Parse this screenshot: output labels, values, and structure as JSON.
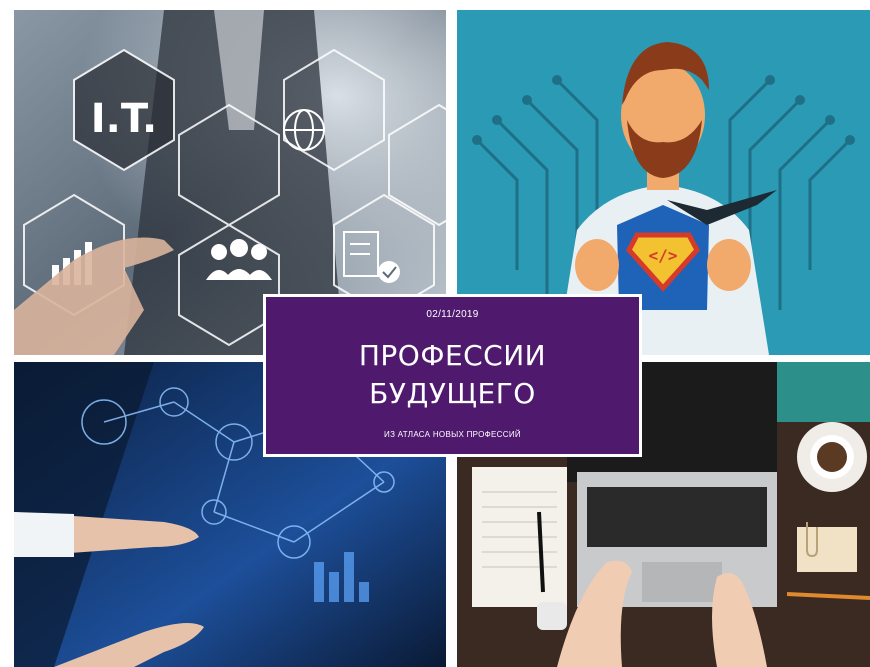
{
  "collage": {
    "date": "02/11/2019",
    "title_line_1": "ПРОФЕССИИ",
    "title_line_2": "БУДУЩЕГО",
    "subtitle": "ИЗ АТЛАСА НОВЫХ ПРОФЕССИЙ",
    "card_color": "#4f1a6e",
    "it_hexagon_text": "I.T."
  },
  "photos": [
    {
      "subject": "it-hexagon-network",
      "icons": [
        "chart-icon",
        "people-icon",
        "globe-icon",
        "document-check-icon",
        "hand-pointer"
      ]
    },
    {
      "subject": "programmer-superhero",
      "icons": [
        "code-emblem-icon",
        "circuit-lines"
      ]
    },
    {
      "subject": "data-visualization-screen",
      "icons": [
        "network-nodes"
      ]
    },
    {
      "subject": "laptop-desk",
      "icons": [
        "laptop",
        "notebook",
        "coffee-cup",
        "paper-clip-icon",
        "pen"
      ]
    }
  ]
}
